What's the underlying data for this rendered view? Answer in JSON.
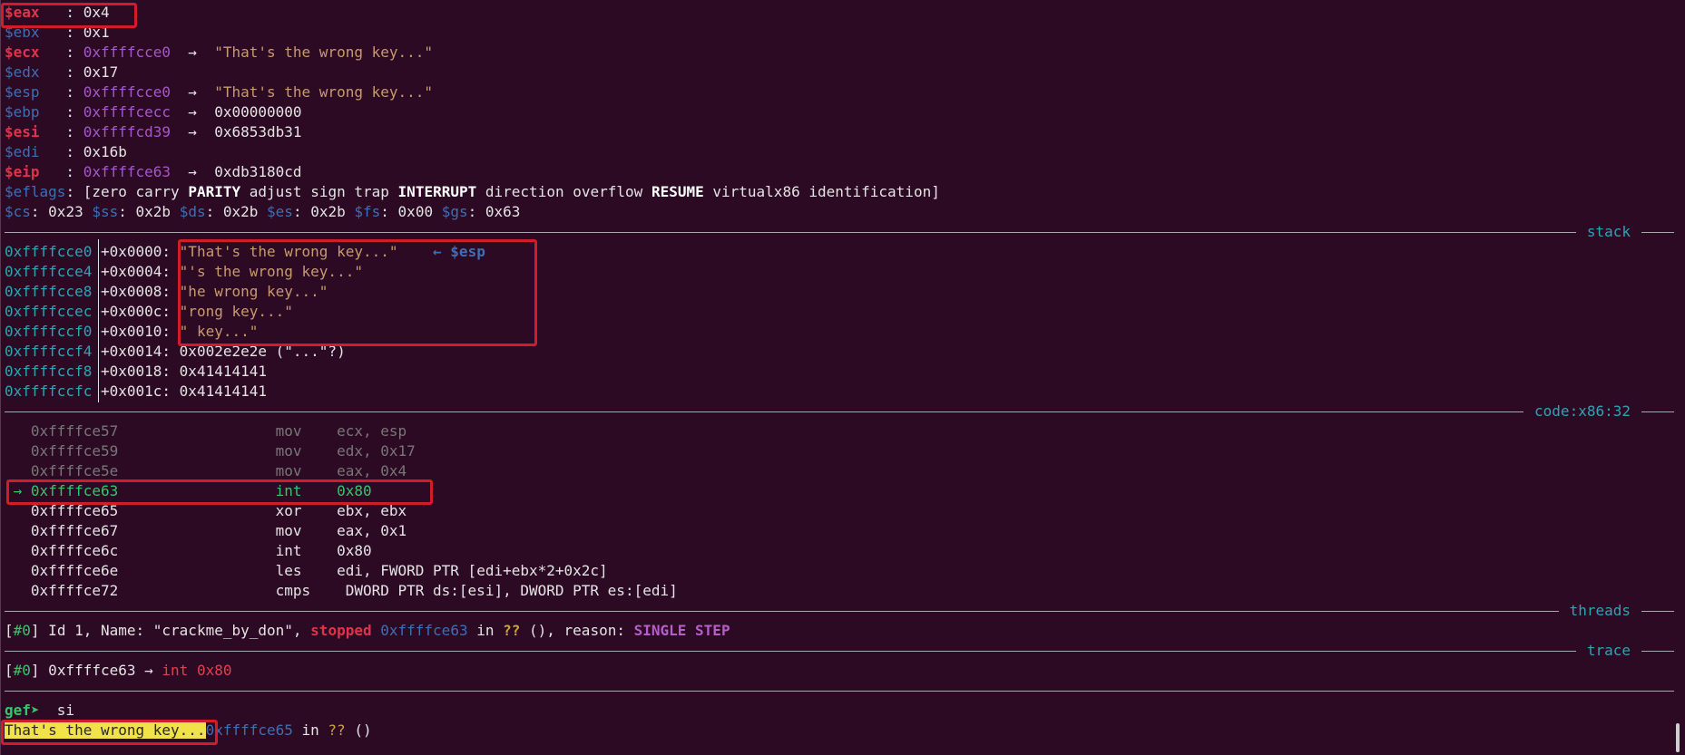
{
  "registers": [
    {
      "name": "$eax",
      "value": "0x4",
      "changed": true
    },
    {
      "name": "$ebx",
      "value": "0x1",
      "changed": false
    },
    {
      "name": "$ecx",
      "value": "0xffffcce0",
      "arrow": "→",
      "target": "\"That's the wrong key...\"",
      "changed": true
    },
    {
      "name": "$edx",
      "value": "0x17",
      "changed": false
    },
    {
      "name": "$esp",
      "value": "0xffffcce0",
      "arrow": "→",
      "target": "\"That's the wrong key...\"",
      "changed": false
    },
    {
      "name": "$ebp",
      "value": "0xffffcecc",
      "arrow": "→",
      "target": "0x00000000",
      "changed": false
    },
    {
      "name": "$esi",
      "value": "0xffffcd39",
      "arrow": "→",
      "target": "0x6853db31",
      "changed": true
    },
    {
      "name": "$edi",
      "value": "0x16b",
      "changed": false
    },
    {
      "name": "$eip",
      "value": "0xffffce63",
      "arrow": "→",
      "target": "0xdb3180cd",
      "changed": true
    }
  ],
  "eflags": {
    "name": "$eflags",
    "open": "[",
    "flags": [
      {
        "t": "zero",
        "on": false
      },
      {
        "t": "carry",
        "on": false
      },
      {
        "t": "PARITY",
        "on": true
      },
      {
        "t": "adjust",
        "on": false
      },
      {
        "t": "sign",
        "on": false
      },
      {
        "t": "trap",
        "on": false
      },
      {
        "t": "INTERRUPT",
        "on": true
      },
      {
        "t": "direction",
        "on": false
      },
      {
        "t": "overflow",
        "on": false
      },
      {
        "t": "RESUME",
        "on": true
      },
      {
        "t": "virtualx86",
        "on": false
      },
      {
        "t": "identification",
        "on": false
      }
    ],
    "close": "]"
  },
  "segments": [
    {
      "name": "$cs",
      "value": "0x23"
    },
    {
      "name": "$ss",
      "value": "0x2b"
    },
    {
      "name": "$ds",
      "value": "0x2b"
    },
    {
      "name": "$es",
      "value": "0x2b"
    },
    {
      "name": "$fs",
      "value": "0x00"
    },
    {
      "name": "$gs",
      "value": "0x63"
    }
  ],
  "sections": {
    "stack": "stack",
    "code": "code:x86:32",
    "threads": "threads",
    "trace": "trace"
  },
  "stack": [
    {
      "addr": "0xffffcce0",
      "off": "+0x0000:",
      "val": "\"That's the wrong key...\"",
      "note": "← $esp"
    },
    {
      "addr": "0xffffcce4",
      "off": "+0x0004:",
      "val": "\"'s the wrong key...\""
    },
    {
      "addr": "0xffffcce8",
      "off": "+0x0008:",
      "val": "\"he wrong key...\""
    },
    {
      "addr": "0xffffccec",
      "off": "+0x000c:",
      "val": "\"rong key...\""
    },
    {
      "addr": "0xffffccf0",
      "off": "+0x0010:",
      "val": "\" key...\""
    },
    {
      "addr": "0xffffccf4",
      "off": "+0x0014:",
      "val": "0x002e2e2e (\"...\"?)"
    },
    {
      "addr": "0xffffccf8",
      "off": "+0x0018:",
      "val": "0x41414141"
    },
    {
      "addr": "0xffffccfc",
      "off": "+0x001c:",
      "val": "0x41414141"
    }
  ],
  "code": [
    {
      "addr": "0xffffce57",
      "mn": "mov",
      "ops": "ecx, esp",
      "state": "past"
    },
    {
      "addr": "0xffffce59",
      "mn": "mov",
      "ops": "edx, 0x17",
      "state": "past"
    },
    {
      "addr": "0xffffce5e",
      "mn": "mov",
      "ops": "eax, 0x4",
      "state": "past"
    },
    {
      "addr": "0xffffce63",
      "mn": "int",
      "ops": "0x80",
      "state": "current",
      "marker": "→"
    },
    {
      "addr": "0xffffce65",
      "mn": "xor",
      "ops": "ebx, ebx",
      "state": "next"
    },
    {
      "addr": "0xffffce67",
      "mn": "mov",
      "ops": "eax, 0x1",
      "state": "next"
    },
    {
      "addr": "0xffffce6c",
      "mn": "int",
      "ops": "0x80",
      "state": "next"
    },
    {
      "addr": "0xffffce6e",
      "mn": "les",
      "ops": "edi, FWORD PTR [edi+ebx*2+0x2c]",
      "state": "next"
    },
    {
      "addr": "0xffffce72",
      "mn": "cmps",
      "ops": "DWORD PTR ds:[esi], DWORD PTR es:[edi]",
      "state": "next"
    }
  ],
  "thread": {
    "open": "[",
    "idx": "#0",
    "close": "]",
    "desc": " Id 1, Name: \"crackme_by_don\", ",
    "status": "stopped",
    "addr": "0xffffce63",
    "in": " in ",
    "func": "??",
    "reason_label": " (), reason: ",
    "reason": "SINGLE STEP"
  },
  "trace": {
    "open": "[",
    "idx": "#0",
    "close": "]",
    "addr": " 0xffffce63 → ",
    "instr": "int 0x80"
  },
  "prompt": {
    "label": "gef➤",
    "command": "si"
  },
  "output": {
    "text": "That's the wrong key...",
    "addr": "0xffffce65",
    "in": " in ",
    "func": "??",
    "tail": " ()"
  },
  "colors": {
    "background": "#2c0a24",
    "highlight_box": "#d11c2a",
    "output_highlight": "#f1e14a"
  }
}
